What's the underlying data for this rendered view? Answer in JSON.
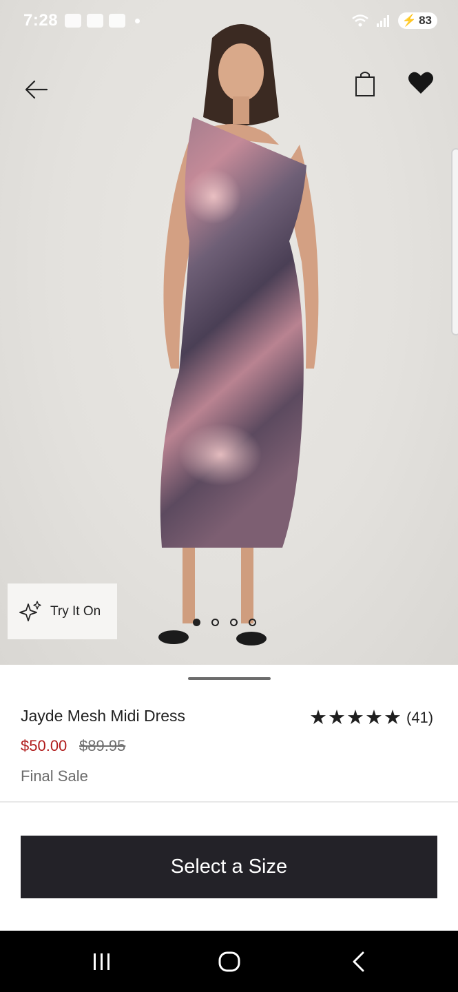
{
  "status_bar": {
    "time": "7:28",
    "battery": "83",
    "icons": [
      "calendar-icon",
      "game-icon",
      "notification-dot-icon",
      "wifi-icon",
      "signal-icon",
      "battery-icon"
    ]
  },
  "header": {
    "icons": [
      "back-arrow-icon",
      "shopping-bag-icon",
      "heart-icon"
    ]
  },
  "gallery": {
    "try_on_label": "Try It On",
    "dots_total": 4,
    "active_index": 0
  },
  "product": {
    "name": "Jayde Mesh Midi Dress",
    "rating_count": "(41)",
    "rating_stars": 5,
    "sale_price": "$50.00",
    "original_price": "$89.95",
    "final_sale": "Final Sale"
  },
  "cta": {
    "select_size": "Select a Size"
  },
  "colors": {
    "sale_price": "#b01b1b",
    "cta_background": "#232228",
    "star": "#1f1f1f"
  }
}
